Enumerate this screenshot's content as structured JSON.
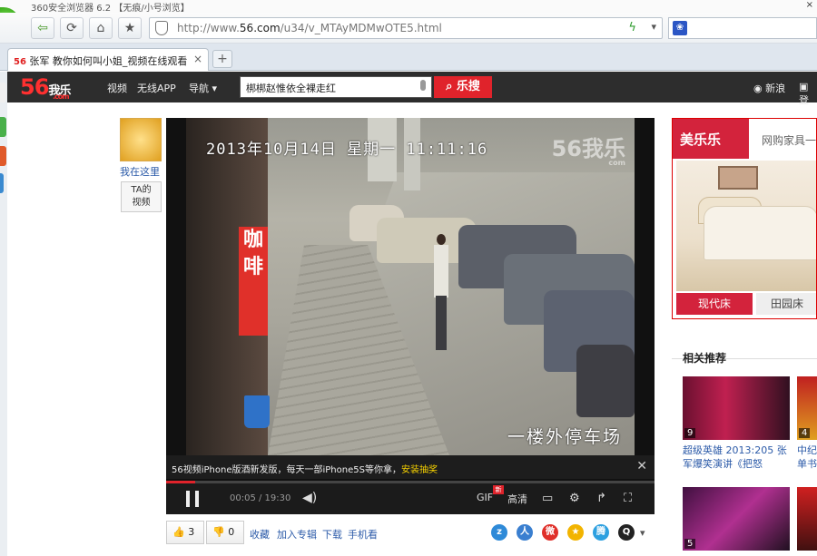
{
  "window": {
    "title": "360安全浏览器 6.2 【无痕/小号浏览】",
    "close": "×"
  },
  "toolbar": {
    "back_icon": "back-arrow-icon",
    "url_prefix": "http://www.",
    "url_host": "56.com",
    "url_path": "/u34/v_MTAyMDMwOTE5.html"
  },
  "tab": {
    "favicon": "56",
    "label": "张军 教你如何叫小姐_视频在线观看",
    "close": "×",
    "new_tab": "+"
  },
  "site": {
    "logo": "56",
    "logo_suffix": "我乐",
    "logo_domain": ".com",
    "nav": [
      "视频",
      "无线APP",
      "导航 ▾"
    ],
    "search_value": "梆梆赵惟依全裸走红",
    "search_button": "乐搜",
    "right": [
      "新浪",
      "登"
    ]
  },
  "uploader": {
    "here": "我在这里",
    "ta_video_line1": "TA的",
    "ta_video_line2": "视频"
  },
  "video": {
    "timestamp": "2013年10月14日 星期一 11:11:16",
    "watermark": "56我乐",
    "watermark_domain": "com",
    "caption": "一楼外停车场",
    "sign_text": "咖啡"
  },
  "notice": {
    "text": "56视频iPhone版酒新发版，每天一部iPhone5S等你拿，",
    "link": "安装抽奖",
    "close": "✕"
  },
  "player": {
    "progress": 0.06,
    "time": "00:05 / 19:30",
    "gif": "GIF",
    "quality": "高清",
    "gif_badge": "新"
  },
  "actions": {
    "like_count": "3",
    "dislike_count": "0",
    "links": [
      "收藏",
      "加入专辑",
      "下载",
      "手机看"
    ]
  },
  "ad": {
    "brand": "美乐乐",
    "tagline": "网购家具一",
    "tab1": "现代床",
    "tab2": "田园床"
  },
  "related": {
    "title": "相关推荐",
    "items": [
      {
        "duration": "9",
        "line1": "超级英雄 2013:205 张",
        "line2": "军爆笑演讲《把怒"
      },
      {
        "duration": "4",
        "line1": "中纪",
        "line2": "单书"
      },
      {
        "duration": "5",
        "line1": "",
        "line2": ""
      },
      {
        "duration": "",
        "line1": "",
        "line2": ""
      }
    ]
  },
  "colors": {
    "accent": "#e0232b",
    "site_header": "#2d2d2d",
    "link": "#2b5aa8"
  }
}
